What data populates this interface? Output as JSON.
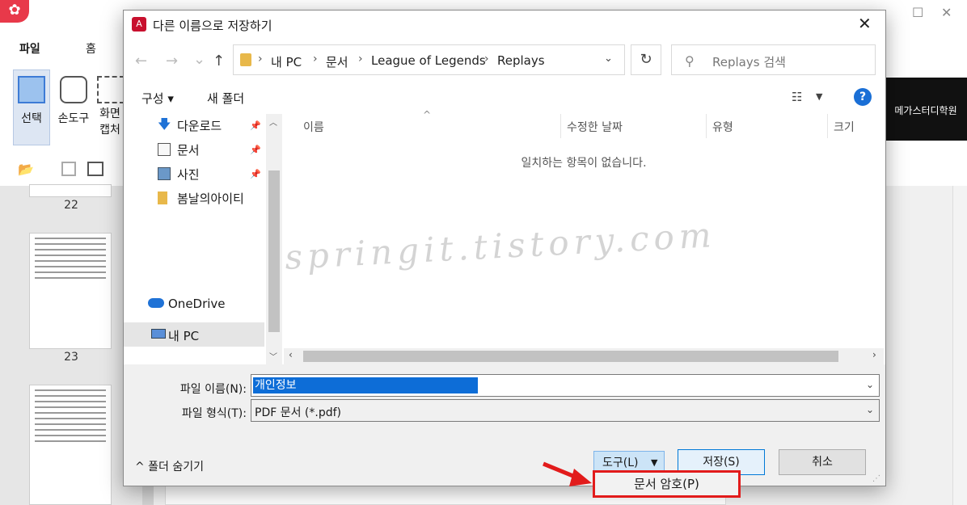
{
  "background_app": {
    "logo_glyph": "✿",
    "ribbon_tabs": [
      "파일",
      "홈"
    ],
    "tools": [
      "선택",
      "손도구",
      "화면",
      "캡처"
    ],
    "thumbnails": [
      {
        "page": "22"
      },
      {
        "page": "23"
      }
    ],
    "banner_text": "메가스터디학원",
    "window_controls": {
      "minimize": "—",
      "maximize": "☐",
      "close": "✕"
    }
  },
  "dialog": {
    "title": "다른 이름으로 저장하기",
    "icon_glyph": "A",
    "close": "✕",
    "nav": {
      "back": "←",
      "forward": "→",
      "history": "⌄",
      "up": "↑"
    },
    "address": {
      "crumbs": [
        "내 PC",
        "문서",
        "League of Legends",
        "Replays"
      ],
      "separator": "›"
    },
    "refresh": "↻",
    "search": {
      "placeholder": "Replays 검색",
      "icon": "search-icon"
    },
    "toolbar": {
      "organize": "구성 ▾",
      "new_folder": "새 폴더",
      "view": "☷",
      "view_drop": "▼",
      "help": "?"
    },
    "nav_pane": {
      "items": [
        {
          "label": "다운로드",
          "icon": "download-icon",
          "pinned": true
        },
        {
          "label": "문서",
          "icon": "document-icon",
          "pinned": true
        },
        {
          "label": "사진",
          "icon": "picture-icon",
          "pinned": true
        },
        {
          "label": "봄날의아이티",
          "icon": "folder-icon",
          "pinned": false
        },
        {
          "label": "OneDrive",
          "icon": "cloud-icon",
          "pinned": false
        },
        {
          "label": "내 PC",
          "icon": "computer-icon",
          "pinned": false,
          "selected": true
        }
      ]
    },
    "list": {
      "columns": [
        "이름",
        "수정한 날짜",
        "유형",
        "크기"
      ],
      "empty_message": "일치하는 항목이 없습니다."
    },
    "form": {
      "filename_label": "파일 이름(N):",
      "filename_value": "개인정보",
      "filetype_label": "파일 형식(T):",
      "filetype_value": "PDF 문서 (*.pdf)"
    },
    "hide_folders": "^  폴더 숨기기",
    "buttons": {
      "tools": "도구(L)",
      "tools_drop": "▼",
      "save": "저장(S)",
      "cancel": "취소"
    },
    "popup_item": "문서 암호(P)"
  },
  "watermark": "springit.tistory.com",
  "colors": {
    "accent": "#0d6dd7",
    "highlight_box": "#e21b1b",
    "brand": "#c8102e"
  }
}
